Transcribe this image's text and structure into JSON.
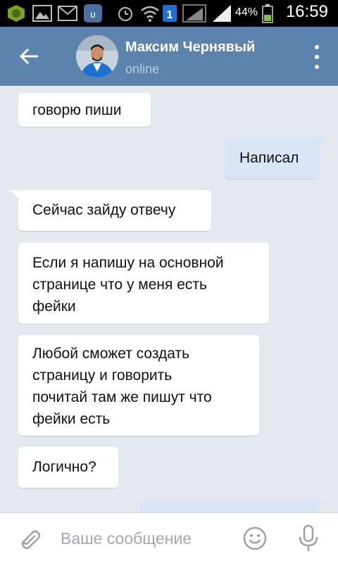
{
  "status_bar": {
    "battery_percent": "44%",
    "time": "16:59",
    "notification_badge": "1"
  },
  "header": {
    "contact_name": "Максим Чернявый",
    "contact_status": "online"
  },
  "messages": [
    {
      "direction": "in",
      "text_lines": [
        "говорю пиши"
      ]
    },
    {
      "direction": "out",
      "text_lines": [
        "Написал"
      ]
    },
    {
      "direction": "in",
      "text_lines": [
        "Сейчас зайду отвечу"
      ]
    },
    {
      "direction": "in",
      "text_lines": [
        "Если я напишу на основной",
        "странице что у меня есть",
        "фейки"
      ]
    },
    {
      "direction": "in",
      "text_lines": [
        "Любой сможет создать",
        "страницу и говорить",
        "почитай там же пишут что",
        "фейки есть"
      ]
    },
    {
      "direction": "in",
      "text_lines": [
        "Логично?"
      ]
    },
    {
      "direction": "out",
      "text_lines": [
        ""
      ]
    }
  ],
  "input": {
    "placeholder": "Ваше сообщение",
    "value": ""
  },
  "colors": {
    "header": "#5b83ad",
    "background": "#e3e9ef",
    "incoming_bubble": "#ffffff",
    "outgoing_bubble": "#d9e6f5"
  },
  "icons": {
    "back": "arrow-left-icon",
    "menu": "vertical-dots-icon",
    "attach": "paperclip-icon",
    "emoji": "smiley-icon",
    "mic": "microphone-icon"
  }
}
